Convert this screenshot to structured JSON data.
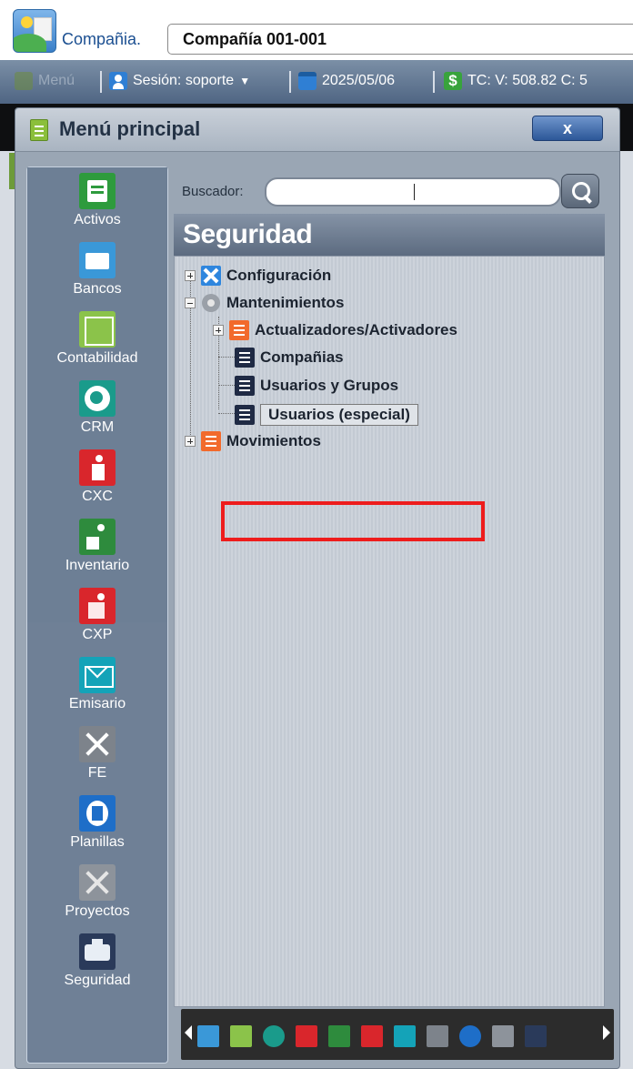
{
  "header": {
    "company_label": "Compañia.",
    "company_value": "Compañía 001-001"
  },
  "toolbar": {
    "menu_label": "Menú",
    "session_label": "Sesión: soporte",
    "date": "2025/05/06",
    "tc_label": "TC:  V: 508.82 C: 5"
  },
  "dialog": {
    "title": "Menú principal",
    "close_label": "x"
  },
  "modules": [
    {
      "label": "Activos",
      "icon": "asset-register-icon"
    },
    {
      "label": "Bancos",
      "icon": "briefcase-icon"
    },
    {
      "label": "Contabilidad",
      "icon": "chart-icon"
    },
    {
      "label": "CRM",
      "icon": "globe-icon"
    },
    {
      "label": "CXC",
      "icon": "person-collect-icon"
    },
    {
      "label": "Inventario",
      "icon": "inventory-icon"
    },
    {
      "label": "CXP",
      "icon": "person-pay-icon"
    },
    {
      "label": "Emisario",
      "icon": "envelope-icon"
    },
    {
      "label": "FE",
      "icon": "tools-icon"
    },
    {
      "label": "Planillas",
      "icon": "document-icon"
    },
    {
      "label": "Proyectos",
      "icon": "tools-icon"
    },
    {
      "label": "Seguridad",
      "icon": "security-icon"
    }
  ],
  "search": {
    "label": "Buscador:",
    "value": ""
  },
  "section_title": "Seguridad",
  "tree": {
    "configuracion": "Configuración",
    "mantenimientos": "Mantenimientos",
    "actualizadores": "Actualizadores/Activadores",
    "companias": "Compañias",
    "usuarios_grupos": "Usuarios y Grupos",
    "usuarios_especial": "Usuarios (especial)",
    "movimientos": "Movimientos"
  },
  "colors": {
    "highlight": "#ee1c1c",
    "title_bar": "#1b4f91"
  }
}
